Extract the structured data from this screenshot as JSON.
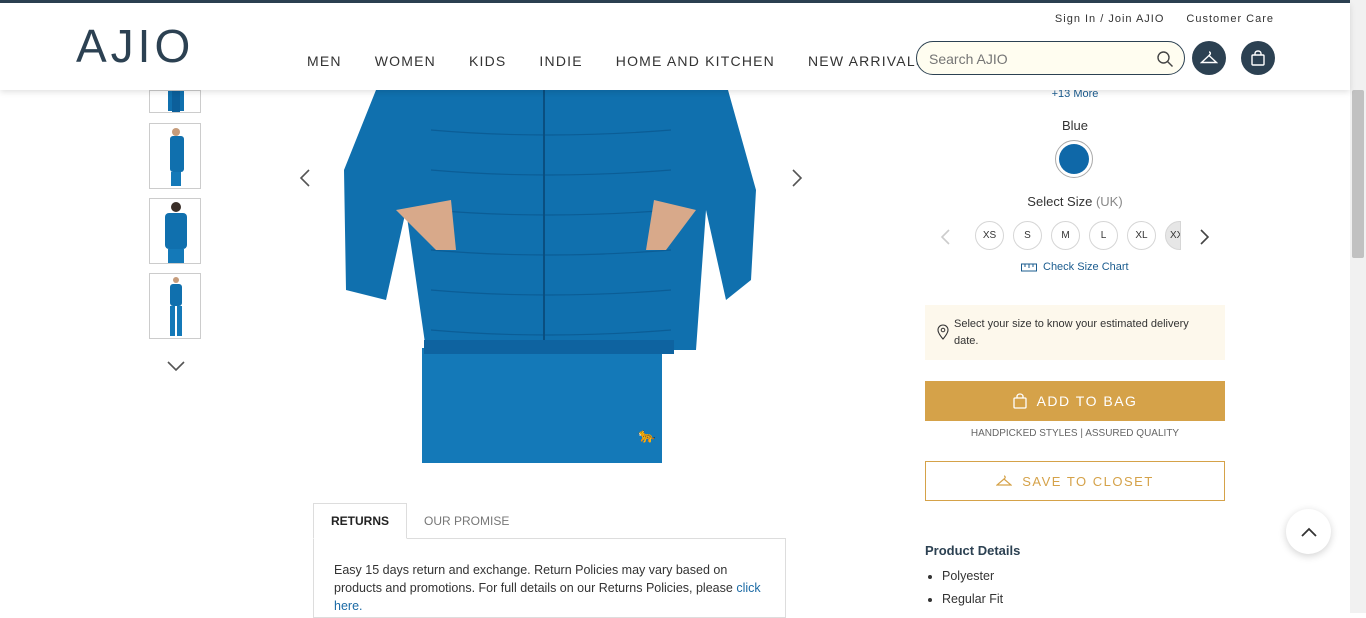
{
  "header": {
    "logo": "AJIO",
    "sign_in": "Sign In / Join AJIO",
    "customer_care": "Customer Care",
    "nav": [
      "MEN",
      "WOMEN",
      "KIDS",
      "INDIE",
      "HOME AND KITCHEN",
      "NEW ARRIVALS"
    ],
    "search_placeholder": "Search AJIO"
  },
  "gallery": {
    "thumbnail_count": 5
  },
  "product": {
    "more_colors": "+13 More",
    "color_name": "Blue",
    "swatch_color": "#0f68a8",
    "size_label": "Select Size",
    "size_unit": "(UK)",
    "sizes": [
      "XS",
      "S",
      "M",
      "L",
      "XL",
      "XX"
    ],
    "size_chart": "Check Size Chart",
    "delivery_note": "Select your size to know your estimated delivery date.",
    "add_to_bag": "ADD TO BAG",
    "tagline": "HANDPICKED STYLES | ASSURED QUALITY",
    "save_to_closet": "SAVE TO CLOSET"
  },
  "tabs": {
    "returns": "RETURNS",
    "our_promise": "OUR PROMISE",
    "returns_text": "Easy 15 days return and exchange. Return Policies may vary based on products and promotions. For full details on our Returns Policies, please",
    "returns_link": "click here."
  },
  "details": {
    "title": "Product Details",
    "items": [
      "Polyester",
      "Regular Fit"
    ]
  },
  "colors": {
    "brand_dark": "#2c4152",
    "accent_gold": "#d5a249",
    "jacket_blue": "#0f68a8",
    "delivery_bg": "#fdf8ec"
  }
}
